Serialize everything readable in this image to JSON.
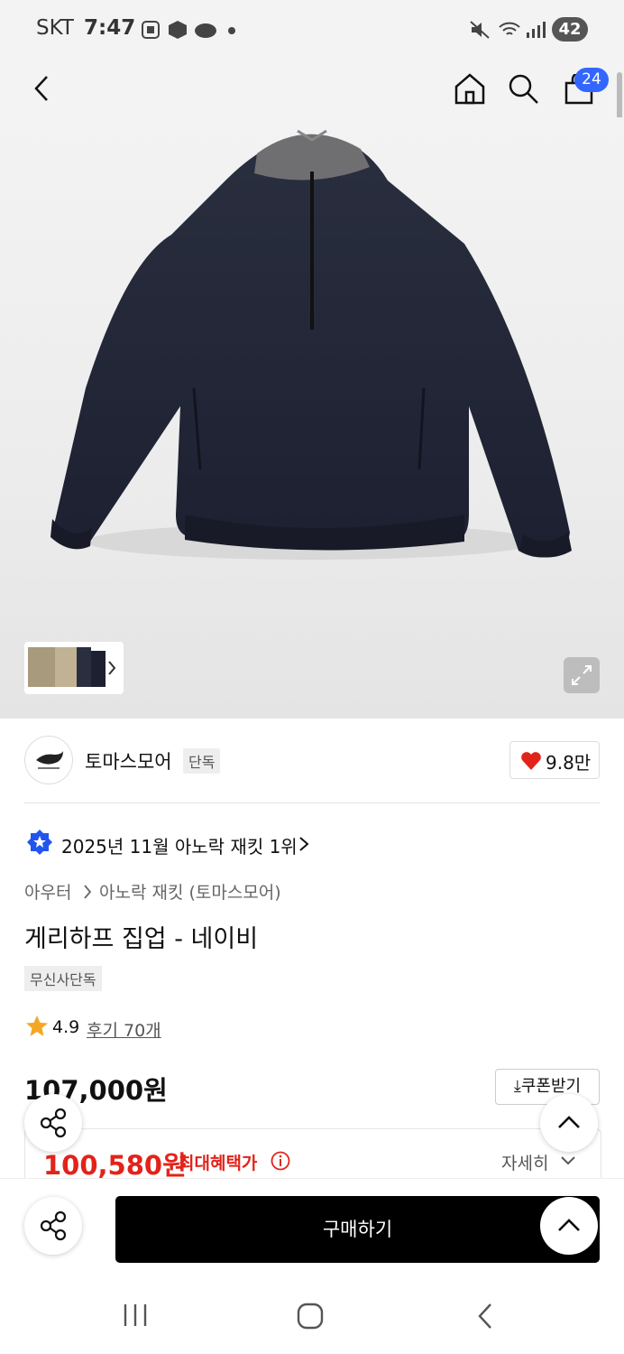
{
  "status_bar": {
    "carrier": "SKT",
    "time": "7:47",
    "battery": "42"
  },
  "nav": {
    "cart_count": "24"
  },
  "brand": {
    "name": "토마스모어",
    "exclusive_label": "단독",
    "likes": "9.8만",
    "heart_color": "#e2231a"
  },
  "ranking": {
    "text": "2025년 11월 아노락 재킷 1위"
  },
  "breadcrumb": {
    "category": "아우터",
    "subcategory": "아노락 재킷 (토마스모어)"
  },
  "product": {
    "title": "게리하프 집업 - 네이비",
    "tag": "무신사단독",
    "rating": "4.9",
    "reviews": "후기 70개",
    "price": "107,000원",
    "coupon_label": "쿠폰받기",
    "sale_price": "100,580원",
    "max_benefit_label": "최대혜택가",
    "detail_label": "자세히"
  },
  "actions": {
    "buy_label": "구매하기"
  },
  "colors": {
    "accent_red": "#e2231a",
    "badge_blue": "#3366ff",
    "jacket_navy": "#1f2331"
  }
}
